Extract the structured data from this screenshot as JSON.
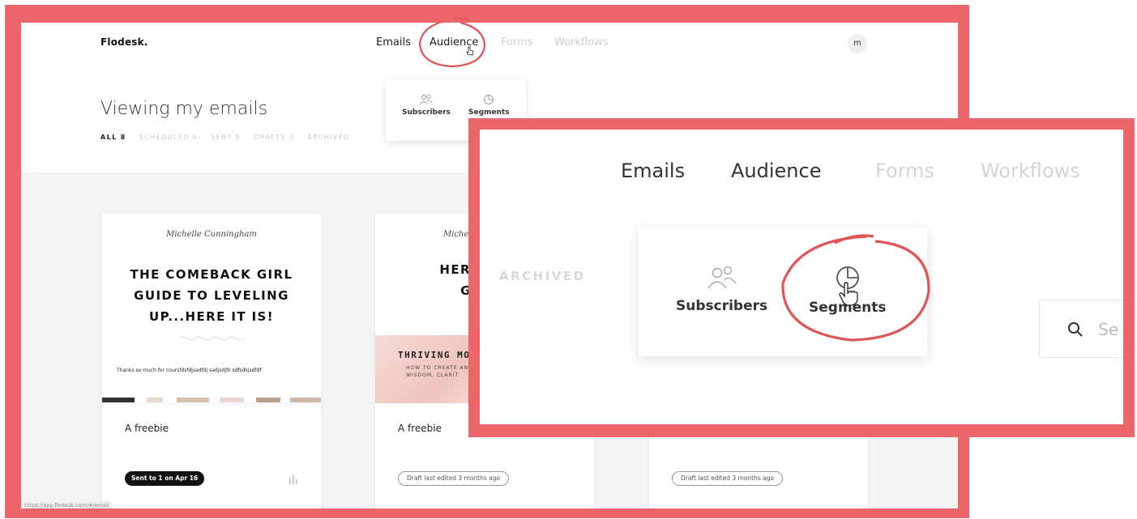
{
  "app": {
    "brand": "Flodesk.",
    "avatar_initial": "m",
    "status_url": "https://app.flodesk.com/#/email"
  },
  "nav": {
    "items": [
      {
        "label": "Emails",
        "state": "default"
      },
      {
        "label": "Audience",
        "state": "hover"
      },
      {
        "label": "Forms",
        "state": "dim"
      },
      {
        "label": "Workflows",
        "state": "dim"
      }
    ]
  },
  "header": {
    "title": "Viewing my emails",
    "filters": [
      "ALL 8",
      "SCHEDULED 0",
      "SENT 5",
      "DRAFTS 3",
      "ARCHIVED"
    ]
  },
  "audience_menu": {
    "items": [
      {
        "label": "Subscribers",
        "icon": "people-icon"
      },
      {
        "label": "Segments",
        "icon": "pie-chart-icon"
      }
    ]
  },
  "cards": [
    {
      "signature": "Michelle Cunningham",
      "headline": [
        "THE COMEBACK GIRL",
        "GUIDE TO LEVELING",
        "UP...HERE IT IS!"
      ],
      "small_text": "Thanks so much for coursfdsfdjsadfdj sadjsdjfk sdfsdkjsdfdf",
      "name": "A freebie",
      "status": "Sent to 1 on Apr 16"
    },
    {
      "signature": "Michelle",
      "headline": [
        "HERE IS MY",
        "GUIDE"
      ],
      "band_title": "THRIVING MO",
      "band_sub": [
        "HOW TO CREATE AN",
        "WISDOM, CLARIT"
      ],
      "name": "A freebie",
      "status": "Draft last edited 3 months ago"
    },
    {
      "status": "Draft last edited 3 months ago"
    }
  ],
  "zoom": {
    "nav": [
      "Emails",
      "Audience",
      "Forms",
      "Workflows"
    ],
    "filter_label": "ARCHIVED",
    "menu": [
      "Subscribers",
      "Segments"
    ],
    "search_placeholder": "Se"
  },
  "colors": {
    "frame": "#ec6669",
    "primary_button": "#111111"
  }
}
